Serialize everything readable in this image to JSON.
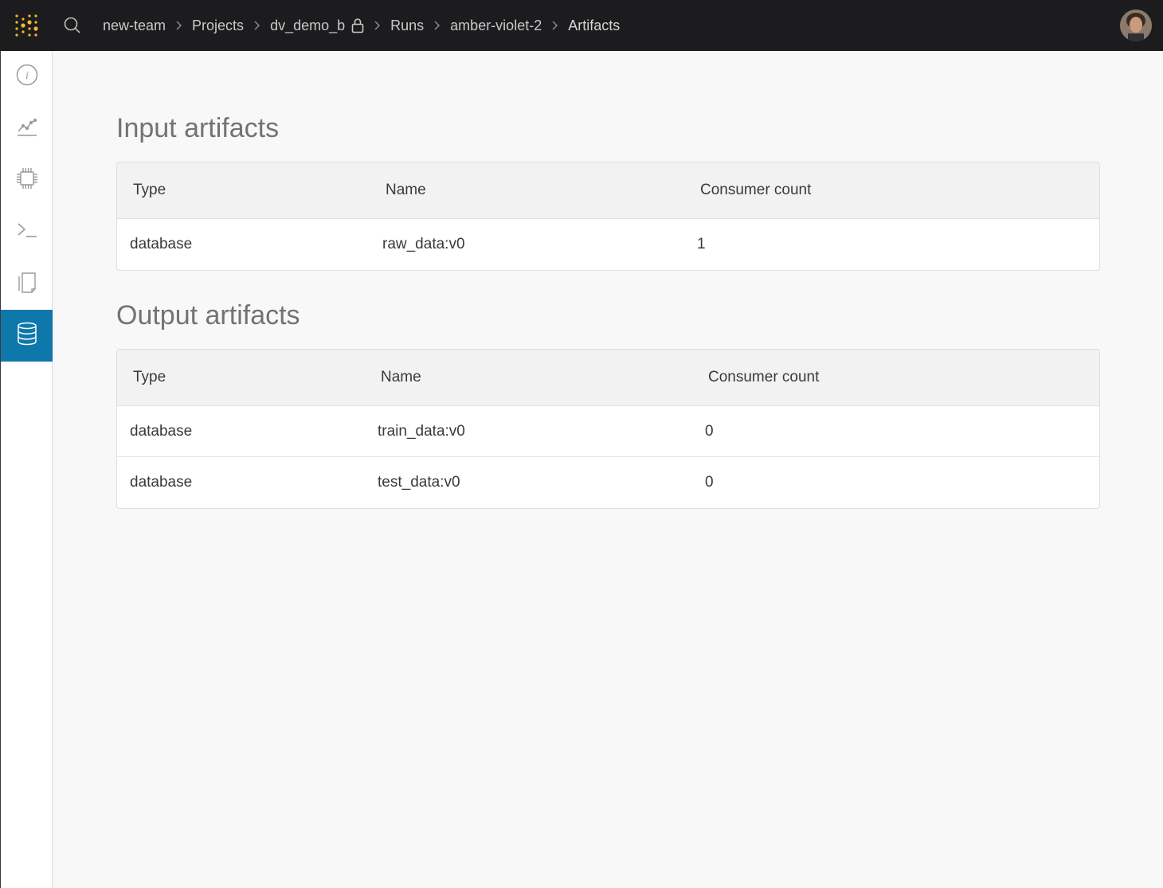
{
  "topbar": {
    "breadcrumbs": [
      "new-team",
      "Projects",
      "dv_demo_b",
      "Runs",
      "amber-violet-2",
      "Artifacts"
    ]
  },
  "sidebar": {
    "items": [
      {
        "icon": "info-icon"
      },
      {
        "icon": "chart-line-icon"
      },
      {
        "icon": "cpu-chip-icon"
      },
      {
        "icon": "terminal-icon"
      },
      {
        "icon": "files-icon"
      },
      {
        "icon": "database-icon",
        "active": true
      }
    ],
    "active_color": "#0e78ab"
  },
  "input_artifacts": {
    "title": "Input artifacts",
    "headers": {
      "type": "Type",
      "name": "Name",
      "consumer_count": "Consumer count"
    },
    "rows": [
      {
        "type": "database",
        "name": "raw_data:v0",
        "consumer_count": "1"
      }
    ]
  },
  "output_artifacts": {
    "title": "Output artifacts",
    "headers": {
      "type": "Type",
      "name": "Name",
      "consumer_count": "Consumer count"
    },
    "rows": [
      {
        "type": "database",
        "name": "train_data:v0",
        "consumer_count": "0"
      },
      {
        "type": "database",
        "name": "test_data:v0",
        "consumer_count": "0"
      }
    ]
  },
  "colors": {
    "topbar": "#1c1c1e",
    "logo_dots": "#f5b830",
    "accent": "#0e78ab"
  }
}
